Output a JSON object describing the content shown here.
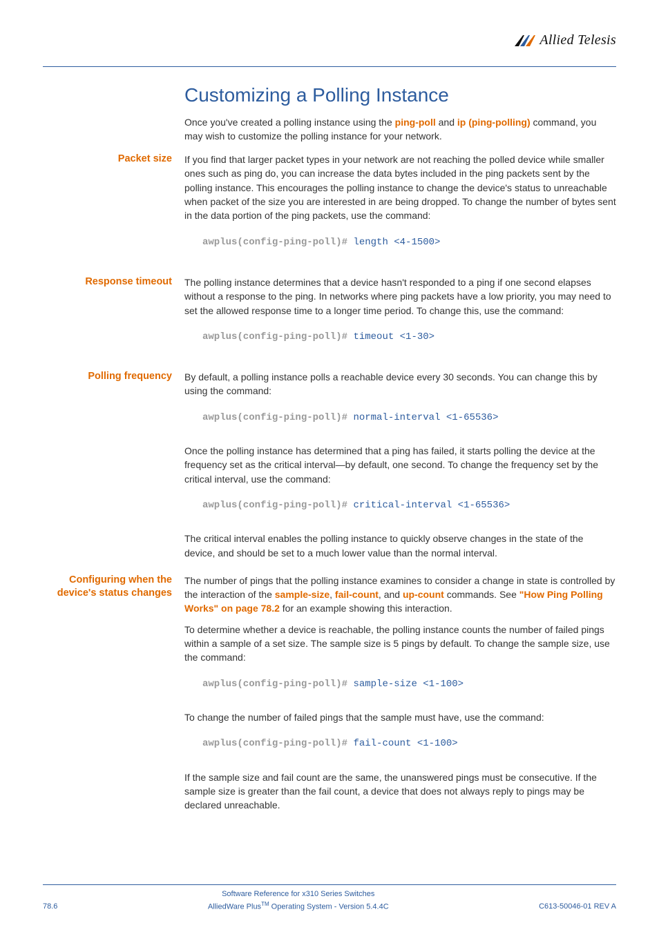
{
  "brand": "Allied Telesis",
  "title": "Customizing a Polling Instance",
  "intro": {
    "pre": "Once you've created a polling instance using the ",
    "link1": "ping-poll",
    "mid1": " and ",
    "link2": "ip (ping-polling)",
    "post": " command, you may wish to customize the polling instance for your network."
  },
  "packet_size": {
    "label": "Packet size",
    "para": "If you find that larger packet types in your network are not reaching the polled device while smaller ones such as ping do, you can increase the data bytes included in the ping packets sent by the polling instance. This encourages the polling instance to change the device's status to unreachable when packet of the size you are interested in are being dropped. To change the number of bytes sent in the data portion of the ping packets, use the command:",
    "prompt": "awplus(config-ping-poll)# ",
    "cmd": "length <4-1500>"
  },
  "response_timeout": {
    "label": "Response timeout",
    "para": "The polling instance determines that a device hasn't responded to a ping if one second elapses without a response to the ping. In networks where ping packets have a low priority, you may need to set the allowed response time to a longer time period. To change this, use the command:",
    "prompt": "awplus(config-ping-poll)# ",
    "cmd": "timeout <1-30>"
  },
  "polling_frequency": {
    "label": "Polling frequency",
    "para1": "By default, a polling instance polls a reachable device every 30 seconds. You can change this by using the command:",
    "prompt1": "awplus(config-ping-poll)# ",
    "cmd1": "normal-interval <1-65536>",
    "para2": "Once the polling instance has determined that a ping has failed, it starts polling the device at the frequency set as the critical interval—by default, one second. To change the frequency set by the critical interval, use the command:",
    "prompt2": "awplus(config-ping-poll)# ",
    "cmd2": "critical-interval <1-65536>",
    "para3": "The critical interval enables the polling instance to quickly observe changes in the state of the device, and should be set to a much lower value than the normal interval."
  },
  "configuring": {
    "label": "Configuring when the device's status changes",
    "para1_pre": "The number of pings that the polling instance examines to consider a change in state is controlled by the interaction of the ",
    "link_ss": "sample-size",
    "sep1": ", ",
    "link_fc": "fail-count",
    "sep2": ", and ",
    "link_uc": "up-count",
    "mid": " commands. See ",
    "link_hpw": "\"How Ping Polling Works\" on page 78.2",
    "para1_post": " for an example showing this interaction.",
    "para2": "To determine whether a device is reachable, the polling instance counts the number of failed pings within a sample of a set size. The sample size is 5 pings by default. To change the sample size, use the command:",
    "prompt1": "awplus(config-ping-poll)# ",
    "cmd1": "sample-size <1-100>",
    "para3": "To change the number of failed pings that the sample must have, use the command:",
    "prompt2": "awplus(config-ping-poll)# ",
    "cmd2": "fail-count <1-100>",
    "para4": "If the sample size and fail count are the same, the unanswered pings must be consecutive. If the sample size is greater than the fail count, a device that does not always reply to pings may be declared unreachable."
  },
  "footer": {
    "page": "78.6",
    "line1": "Software Reference for x310 Series Switches",
    "line2_pre": "AlliedWare Plus",
    "line2_tm": "TM",
    "line2_post": " Operating System  - Version 5.4.4C",
    "rev": "C613-50046-01 REV A"
  }
}
